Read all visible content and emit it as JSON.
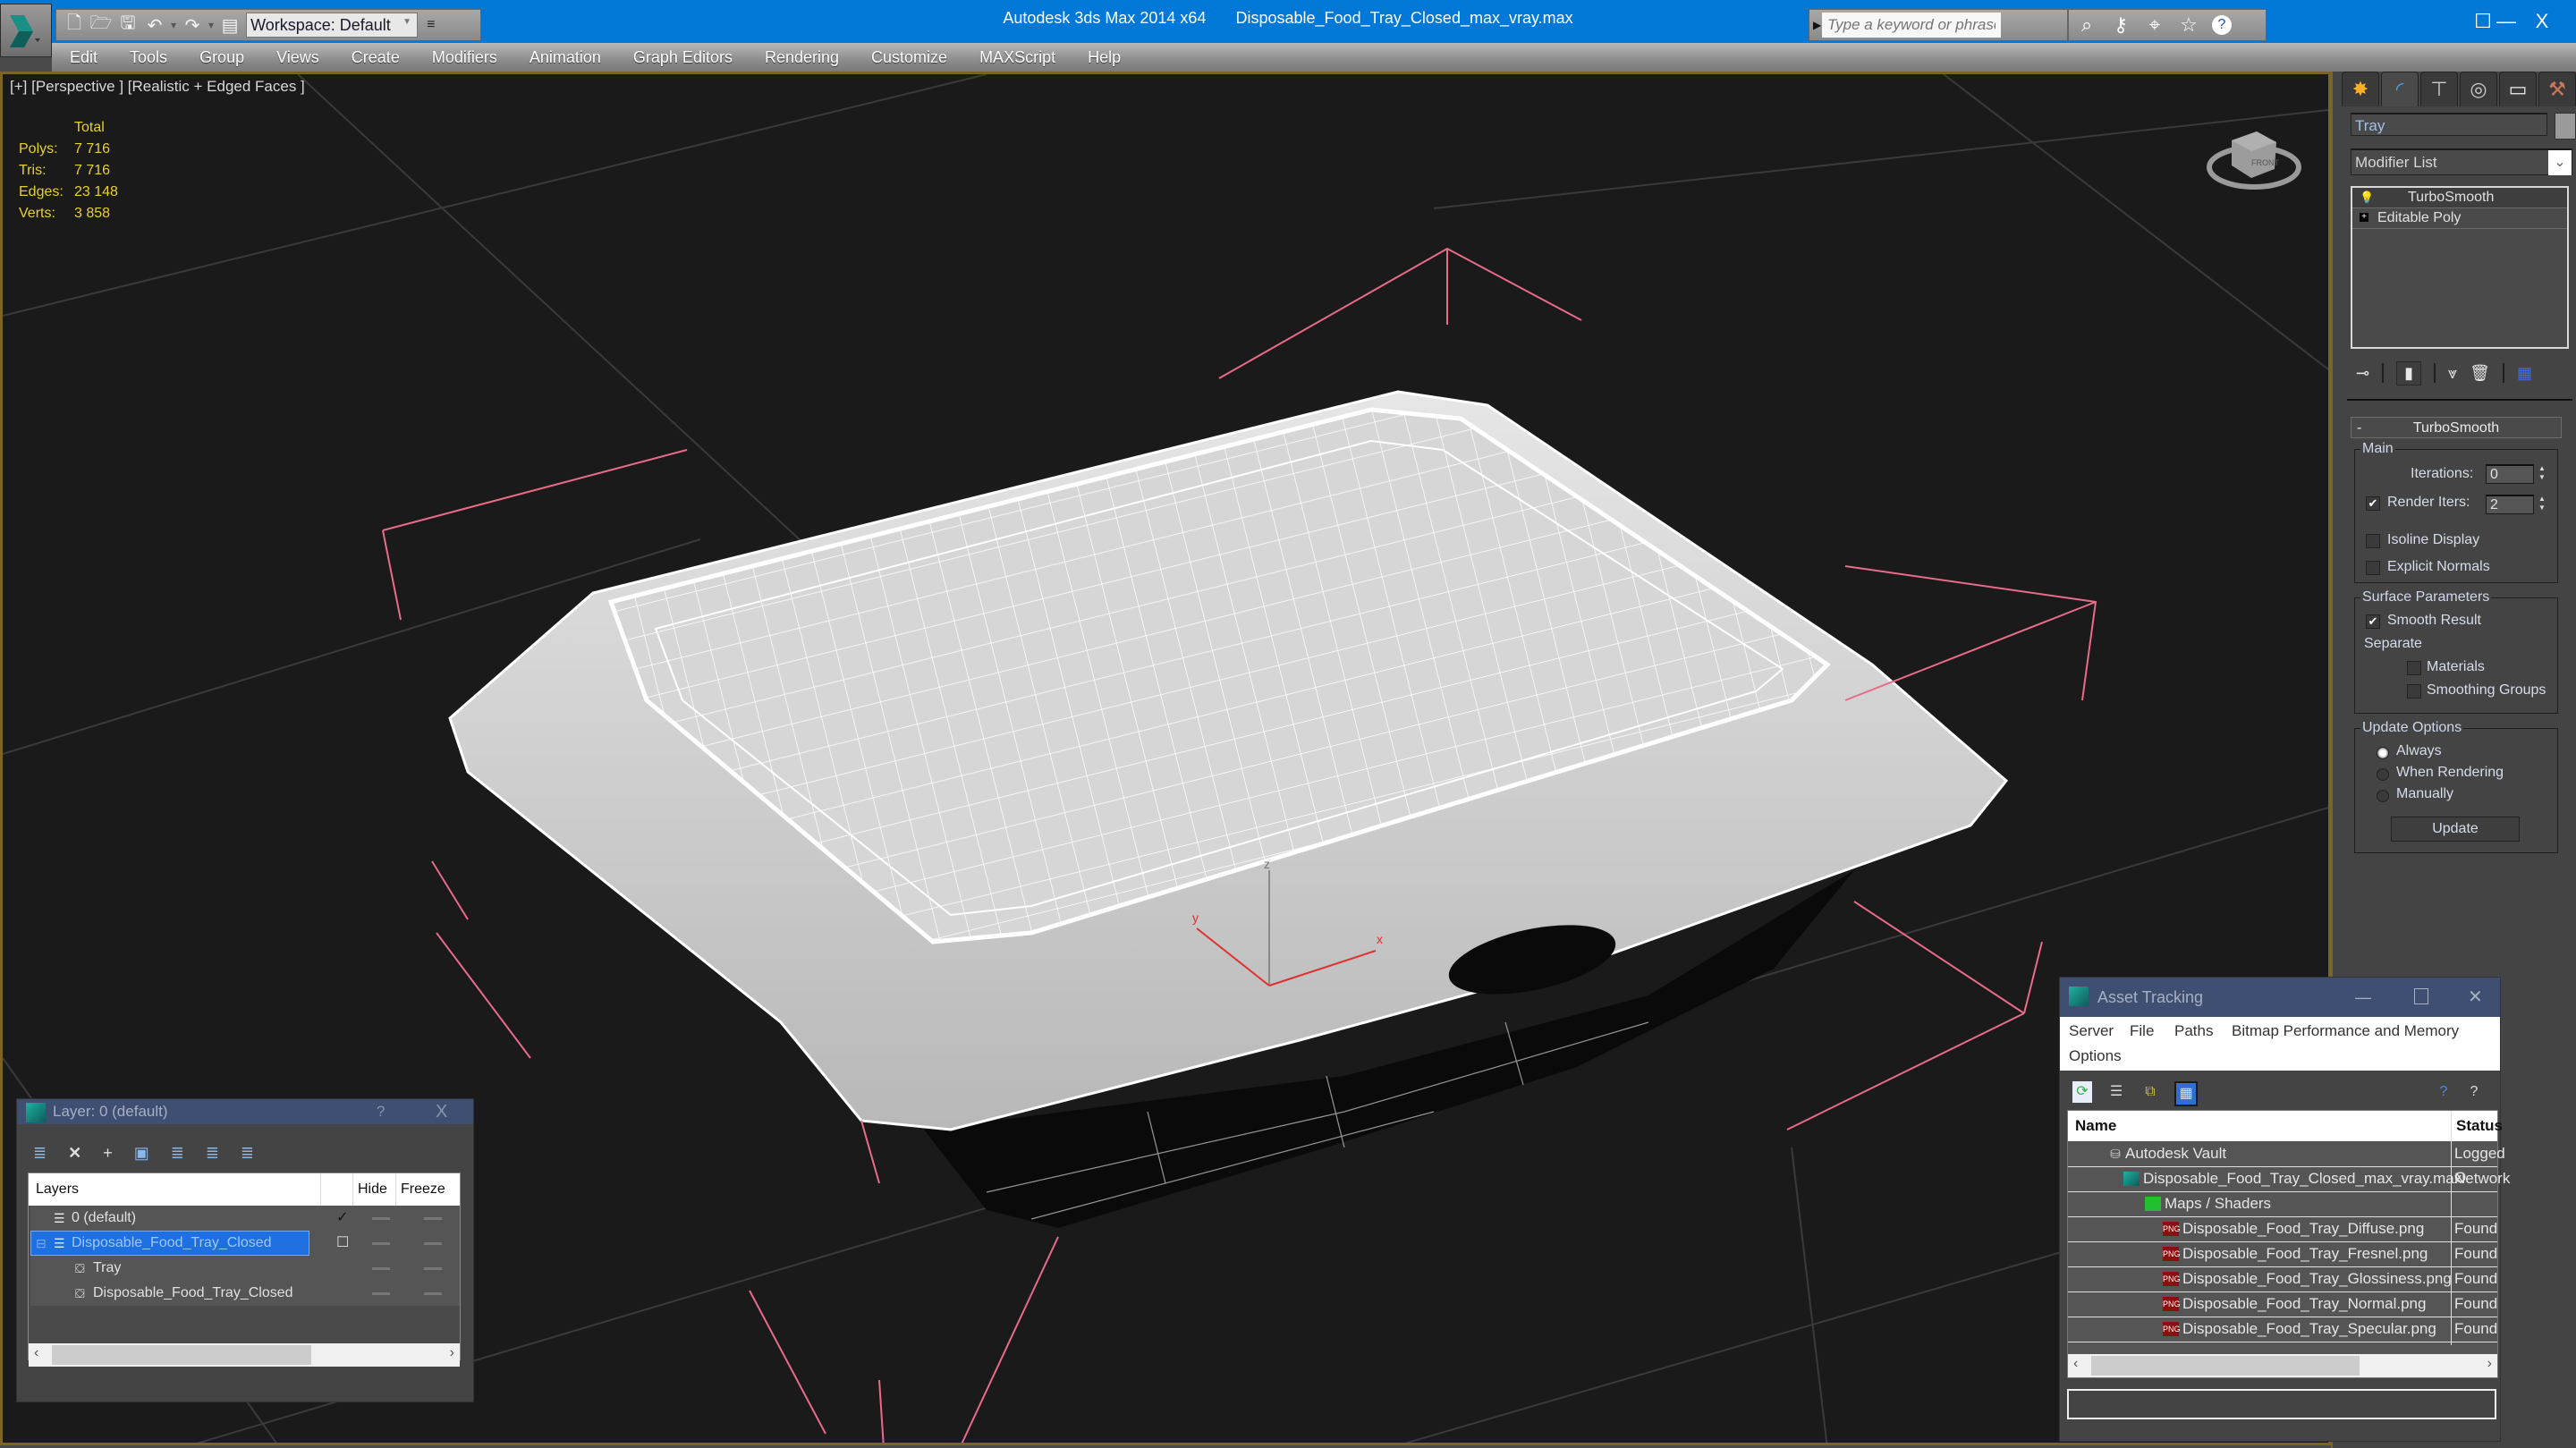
{
  "app": {
    "title": "Autodesk 3ds Max  2014 x64",
    "file": "Disposable_Food_Tray_Closed_max_vray.max",
    "logo_icon": "3dsmax-logo-icon"
  },
  "quick_access": {
    "icons": [
      "new-file-icon",
      "open-folder-icon",
      "save-icon",
      "undo-icon",
      "redo-icon",
      "project-folder-icon"
    ],
    "workspace": "Workspace: Default"
  },
  "search": {
    "placeholder": "Type a keyword or phrase",
    "tool_icons": [
      "binoculars-icon",
      "key-icon",
      "satellite-icon",
      "star-icon",
      "help-icon"
    ]
  },
  "window_controls": {
    "minimize": "—",
    "maximize": "☐",
    "close": "X"
  },
  "menu": [
    "Edit",
    "Tools",
    "Group",
    "Views",
    "Create",
    "Modifiers",
    "Animation",
    "Graph Editors",
    "Rendering",
    "Customize",
    "MAXScript",
    "Help"
  ],
  "viewport": {
    "label": "[+] [Perspective ] [Realistic + Edged Faces ]",
    "stats": {
      "header": "Total",
      "rows": [
        {
          "label": "Polys:",
          "value": "7 716"
        },
        {
          "label": "Tris:",
          "value": "7 716"
        },
        {
          "label": "Edges:",
          "value": "23 148"
        },
        {
          "label": "Verts:",
          "value": "3 858"
        }
      ]
    },
    "gizmo": {
      "x": "x",
      "y": "y",
      "z": "z"
    },
    "viewcube_face": "FRONT"
  },
  "command_panel": {
    "tabs": [
      "create-icon",
      "modify-icon",
      "hierarchy-icon",
      "motion-icon",
      "display-icon",
      "utilities-icon"
    ],
    "object_name": "Tray",
    "object_color": "#9a9a9a",
    "modifier_list": "Modifier List",
    "stack": [
      {
        "label": "TurboSmooth",
        "icon": "lightbulb-icon"
      },
      {
        "label": "Editable Poly",
        "icon": "expand-plus-icon"
      }
    ],
    "stack_tools": [
      "pin-stack-icon",
      "show-end-result-icon",
      "make-unique-icon",
      "remove-modifier-icon",
      "configure-sets-icon"
    ],
    "rollout": {
      "title": "TurboSmooth",
      "collapse": "-",
      "main": {
        "title": "Main",
        "iterations_label": "Iterations:",
        "iterations_value": "0",
        "render_iters_label": "Render Iters:",
        "render_iters_value": "2",
        "render_iters_checked": true,
        "isoline_label": "Isoline Display",
        "isoline_checked": false,
        "explicit_normals_label": "Explicit Normals",
        "explicit_normals_checked": false
      },
      "surface": {
        "title": "Surface Parameters",
        "smooth_result_label": "Smooth Result",
        "smooth_result_checked": true,
        "separate_label": "Separate",
        "materials_label": "Materials",
        "materials_checked": false,
        "smoothing_groups_label": "Smoothing Groups",
        "smoothing_groups_checked": false
      },
      "update": {
        "title": "Update Options",
        "options": [
          "Always",
          "When Rendering",
          "Manually"
        ],
        "selected": "Always",
        "button": "Update"
      }
    }
  },
  "layer_dialog": {
    "title": "Layer: 0 (default)",
    "help": "?",
    "close": "X",
    "tools": [
      "create-layer-icon",
      "delete-layer-icon",
      "add-to-layer-icon",
      "select-objects-icon",
      "select-layer-icon",
      "highlight-layer-icon",
      "freeze-layer-icon"
    ],
    "columns": [
      "Layers",
      "",
      "Hide",
      "Freeze"
    ],
    "rows": [
      {
        "name": "0 (default)",
        "icon": "layer-stack-icon",
        "active": "✓",
        "selected": false,
        "indent": 1
      },
      {
        "name": "Disposable_Food_Tray_Closed",
        "icon": "layer-stack-icon",
        "active": "☐",
        "selected": true,
        "indent": 1
      },
      {
        "name": "Tray",
        "icon": "object-icon",
        "active": "",
        "selected": false,
        "indent": 2
      },
      {
        "name": "Disposable_Food_Tray_Closed",
        "icon": "object-icon",
        "active": "",
        "selected": false,
        "indent": 2
      }
    ]
  },
  "asset_tracking": {
    "title": "Asset Tracking",
    "menu": [
      "Server",
      "File",
      "Paths",
      "Bitmap Performance and Memory",
      "Options"
    ],
    "tools": [
      "refresh-icon",
      "list-view-icon",
      "tree-view-icon",
      "table-view-icon"
    ],
    "help_icons": [
      "help-globe-icon",
      "help-pointer-icon"
    ],
    "columns": [
      "Name",
      "Status"
    ],
    "rows": [
      {
        "name": "Autodesk Vault",
        "status": "Logged O",
        "icon": "vault-icon",
        "indent": 1
      },
      {
        "name": "Disposable_Food_Tray_Closed_max_vray.max",
        "status": "Network",
        "icon": "max-file-icon",
        "indent": 2
      },
      {
        "name": "Maps / Shaders",
        "status": "",
        "icon": "maps-icon",
        "indent": 3
      },
      {
        "name": "Disposable_Food_Tray_Diffuse.png",
        "status": "Found",
        "icon": "png-icon",
        "indent": 4
      },
      {
        "name": "Disposable_Food_Tray_Fresnel.png",
        "status": "Found",
        "icon": "png-icon",
        "indent": 4
      },
      {
        "name": "Disposable_Food_Tray_Glossiness.png",
        "status": "Found",
        "icon": "png-icon",
        "indent": 4
      },
      {
        "name": "Disposable_Food_Tray_Normal.png",
        "status": "Found",
        "icon": "png-icon",
        "indent": 4
      },
      {
        "name": "Disposable_Food_Tray_Specular.png",
        "status": "Found",
        "icon": "png-icon",
        "indent": 4
      }
    ]
  }
}
